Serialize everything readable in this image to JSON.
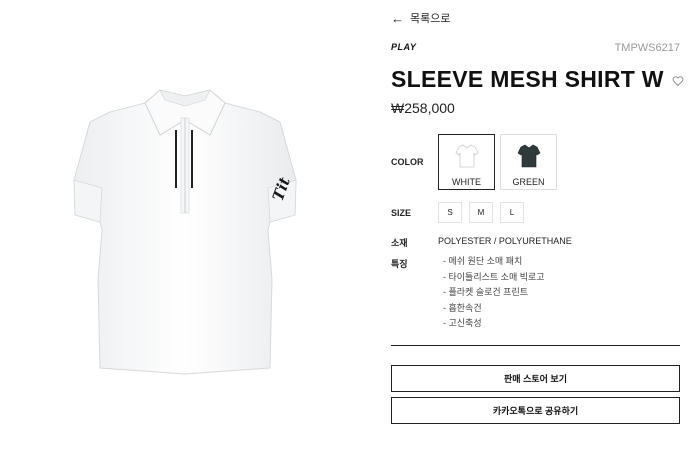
{
  "nav": {
    "back_label": "목록으로"
  },
  "product": {
    "brand": "PLAY",
    "code": "TMPWS6217",
    "name": "SLEEVE MESH SHIRT W",
    "price": "₩258,000",
    "logo_text": "Titleist"
  },
  "options": {
    "color_label": "COLOR",
    "colors": [
      {
        "name": "WHITE",
        "hex": "#ffffff",
        "selected": true
      },
      {
        "name": "GREEN",
        "hex": "#2f3a3c",
        "selected": false
      }
    ],
    "size_label": "SIZE",
    "sizes": [
      "S",
      "M",
      "L"
    ]
  },
  "details": {
    "material_label": "소재",
    "material_value": "POLYESTER / POLYURETHANE",
    "features_label": "특징",
    "features": [
      "메쉬 원단 소매 패치",
      "타이틀리스트 소매 빅로고",
      "플라켓 슬로건 프린트",
      "흡한속건",
      "고신축성"
    ]
  },
  "actions": {
    "store_button": "판매 스토어 보기",
    "share_button": "카카오톡으로 공유하기"
  },
  "colors": {
    "accent": "#111111",
    "muted": "#9a9a9a",
    "border": "#dddddd"
  },
  "icons": {
    "back": "arrow-left-icon",
    "wish": "heart-outline-icon"
  }
}
